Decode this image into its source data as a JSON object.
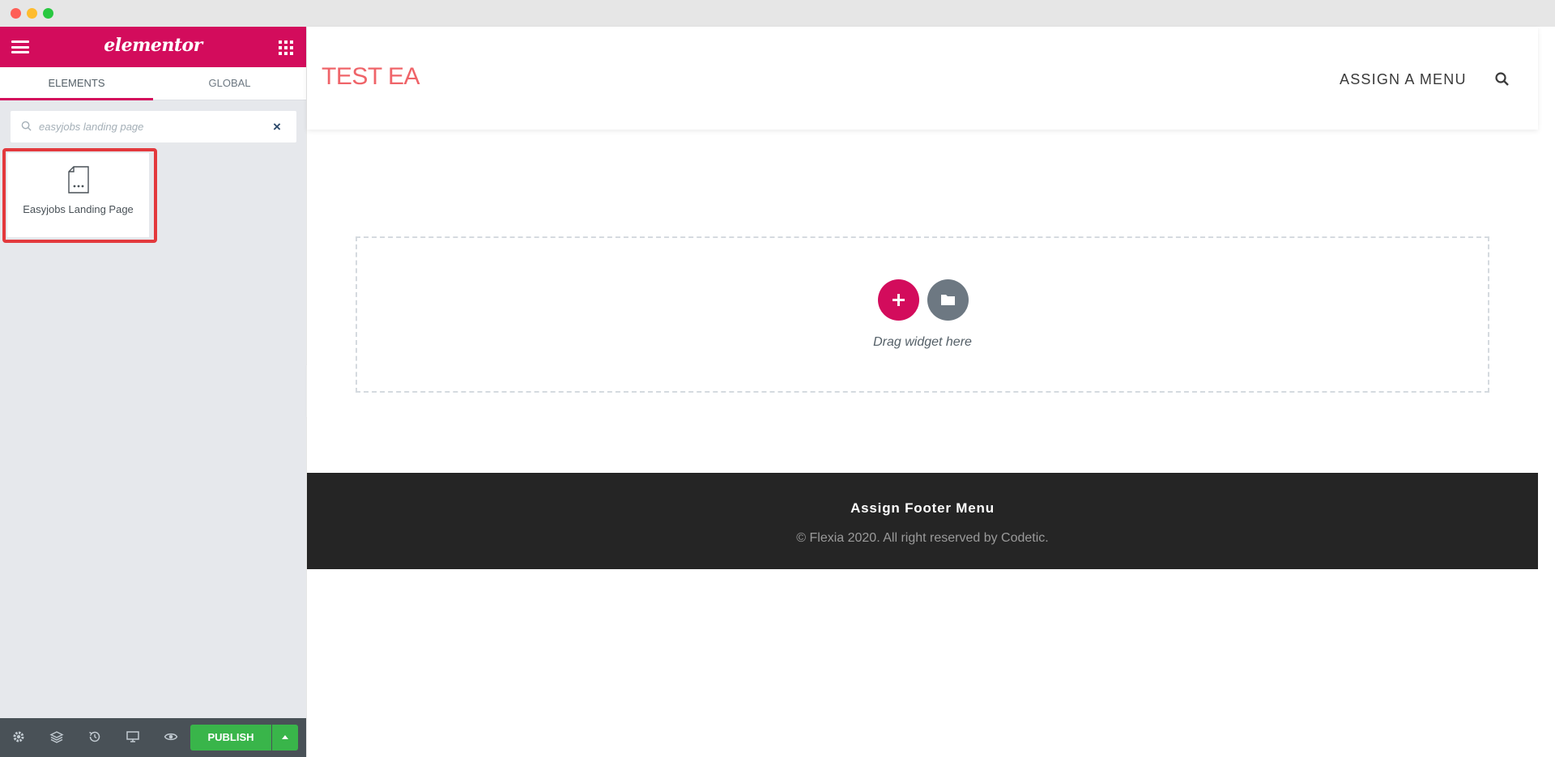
{
  "window": {
    "title": ""
  },
  "panel": {
    "logo_text": "elementor",
    "tabs": [
      {
        "label": "ELEMENTS",
        "active": true
      },
      {
        "label": "GLOBAL",
        "active": false
      }
    ],
    "search": {
      "value": "",
      "placeholder": "easyjobs landing page"
    },
    "widgets": [
      {
        "label": "Easyjobs Landing Page",
        "icon": "document-icon",
        "highlighted": true
      }
    ],
    "footer": {
      "icons": [
        "settings-icon",
        "navigator-icon",
        "history-icon",
        "responsive-mode-icon",
        "preview-icon"
      ],
      "publish_label": "PUBLISH"
    }
  },
  "preview": {
    "site_title": "TEST EA",
    "menu_label": "ASSIGN A MENU",
    "drop_zone_text": "Drag widget here",
    "footer_menu": "Assign Footer Menu",
    "footer_copyright": "© Flexia 2020. All right reserved by Codetic."
  },
  "colors": {
    "brand": "#d30c5c",
    "publish": "#39b54a",
    "site_title": "#ef6469",
    "footer_bg": "#252525",
    "highlight_border": "#e3393d"
  }
}
